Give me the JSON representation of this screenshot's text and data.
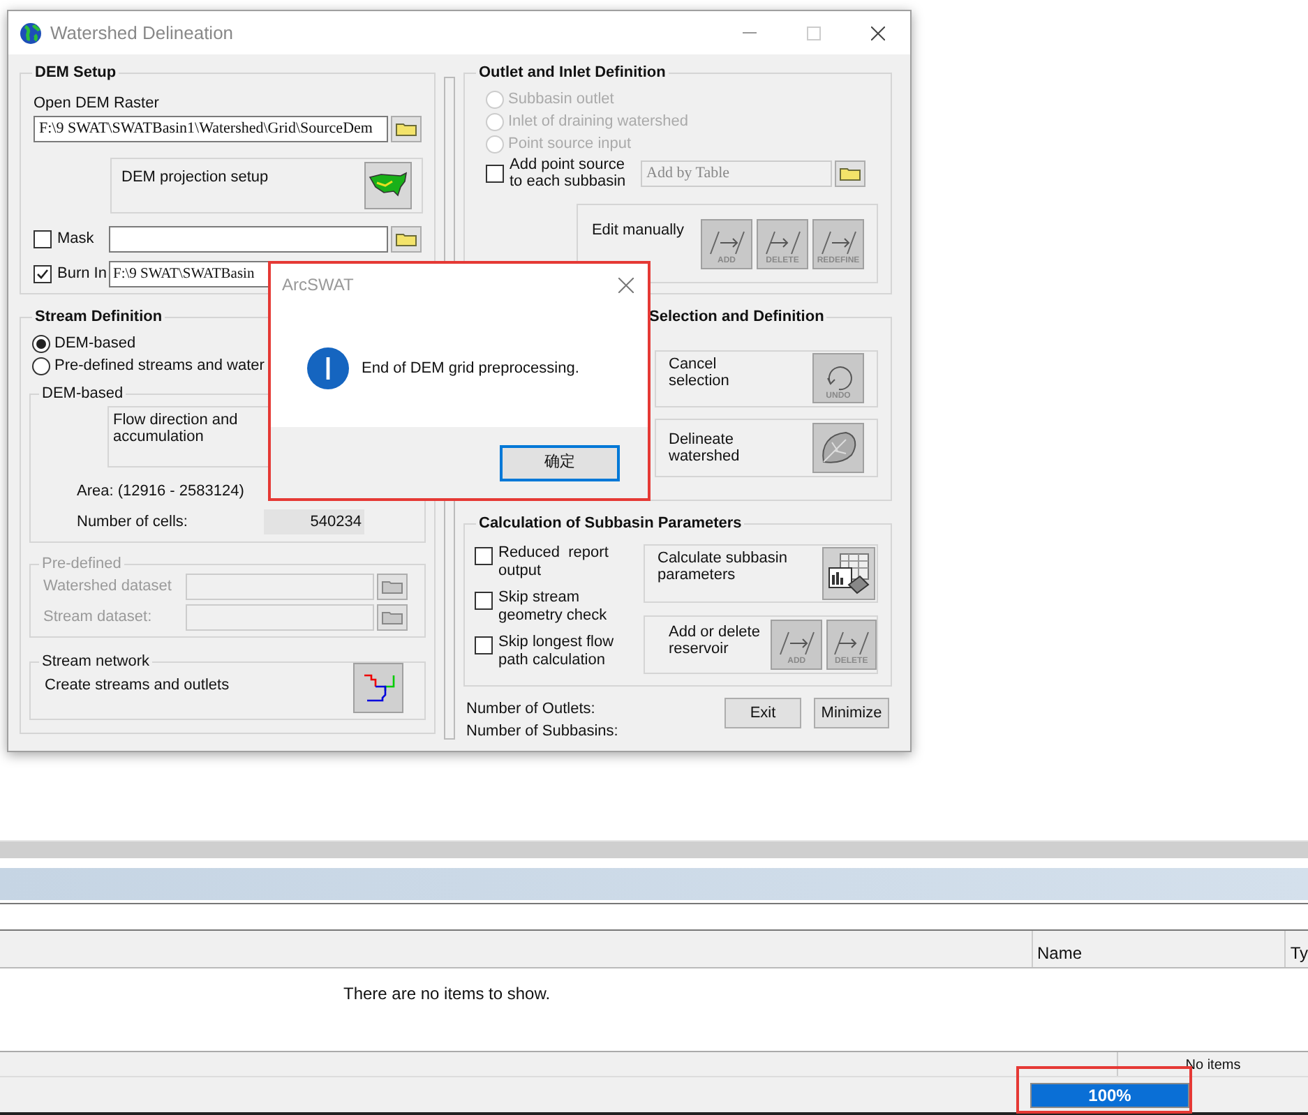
{
  "window": {
    "title": "Watershed Delineation"
  },
  "dem_setup": {
    "title": "DEM Setup",
    "open_label": "Open DEM Raster",
    "dem_path": "F:\\9 SWAT\\SWATBasin1\\Watershed\\Grid\\SourceDem",
    "projection_label": "DEM projection setup",
    "mask": {
      "label": "Mask",
      "checked": false
    },
    "burn_in": {
      "label": "Burn In",
      "checked": true,
      "path": "F:\\9 SWAT\\SWATBasin"
    }
  },
  "stream_definition": {
    "title": "Stream Definition",
    "options": [
      {
        "label": "DEM-based",
        "selected": true
      },
      {
        "label": "Pre-defined streams and water",
        "selected": false
      }
    ],
    "dem_based": {
      "title": "DEM-based",
      "flow_label": "Flow direction and accumulation",
      "area_label": "Area: (12916 - 2583124)",
      "cells_label": "Number of cells:",
      "cells_value": "540234"
    },
    "pre_defined": {
      "title": "Pre-defined",
      "disabled": true,
      "watershed_label": "Watershed dataset",
      "stream_label": "Stream dataset:"
    },
    "stream_network": {
      "title": "Stream network",
      "label": "Create streams and outlets"
    }
  },
  "outlet_inlet": {
    "title": "Outlet and Inlet Definition",
    "options": [
      {
        "label": "Subbasin outlet",
        "selected": false,
        "disabled": true
      },
      {
        "label": "Inlet of draining watershed",
        "selected": false,
        "disabled": true
      },
      {
        "label": "Point source input",
        "selected": false,
        "disabled": true
      }
    ],
    "point_source": {
      "label": "Add point source to each subbasin",
      "checked": false
    },
    "table_field": {
      "placeholder": "Add by Table"
    },
    "edit_manually": {
      "label": "Edit manually",
      "buttons": [
        "ADD",
        "DELETE",
        "REDEFINE"
      ]
    }
  },
  "watershed_selection": {
    "title": "Selection and Definition",
    "cancel_label": "Cancel selection",
    "cancel_icon": "UNDO",
    "delineate_label": "Delineate watershed"
  },
  "calculation": {
    "title": "Calculation of Subbasin Parameters",
    "checks": [
      {
        "label": "Reduced  report output",
        "checked": false
      },
      {
        "label": "Skip stream geometry check",
        "checked": false
      },
      {
        "label": "Skip longest flow path calculation",
        "checked": false
      }
    ],
    "calc_label": "Calculate subbasin parameters",
    "reservoir_label": "Add or delete reservoir",
    "reservoir_buttons": [
      "ADD",
      "DELETE"
    ]
  },
  "footer": {
    "outlets_label": "Number of Outlets:",
    "subbasins_label": "Number of Subbasins:",
    "buttons": [
      "Exit",
      "Minimize"
    ]
  },
  "dialog": {
    "title": "ArcSWAT",
    "message": "End of DEM grid preprocessing.",
    "ok": "确定"
  },
  "catalog": {
    "columns": [
      "Name",
      "Ty"
    ],
    "empty": "There are no items to show.",
    "status": "No items",
    "progress": {
      "level": 1,
      "text": "100%"
    }
  }
}
